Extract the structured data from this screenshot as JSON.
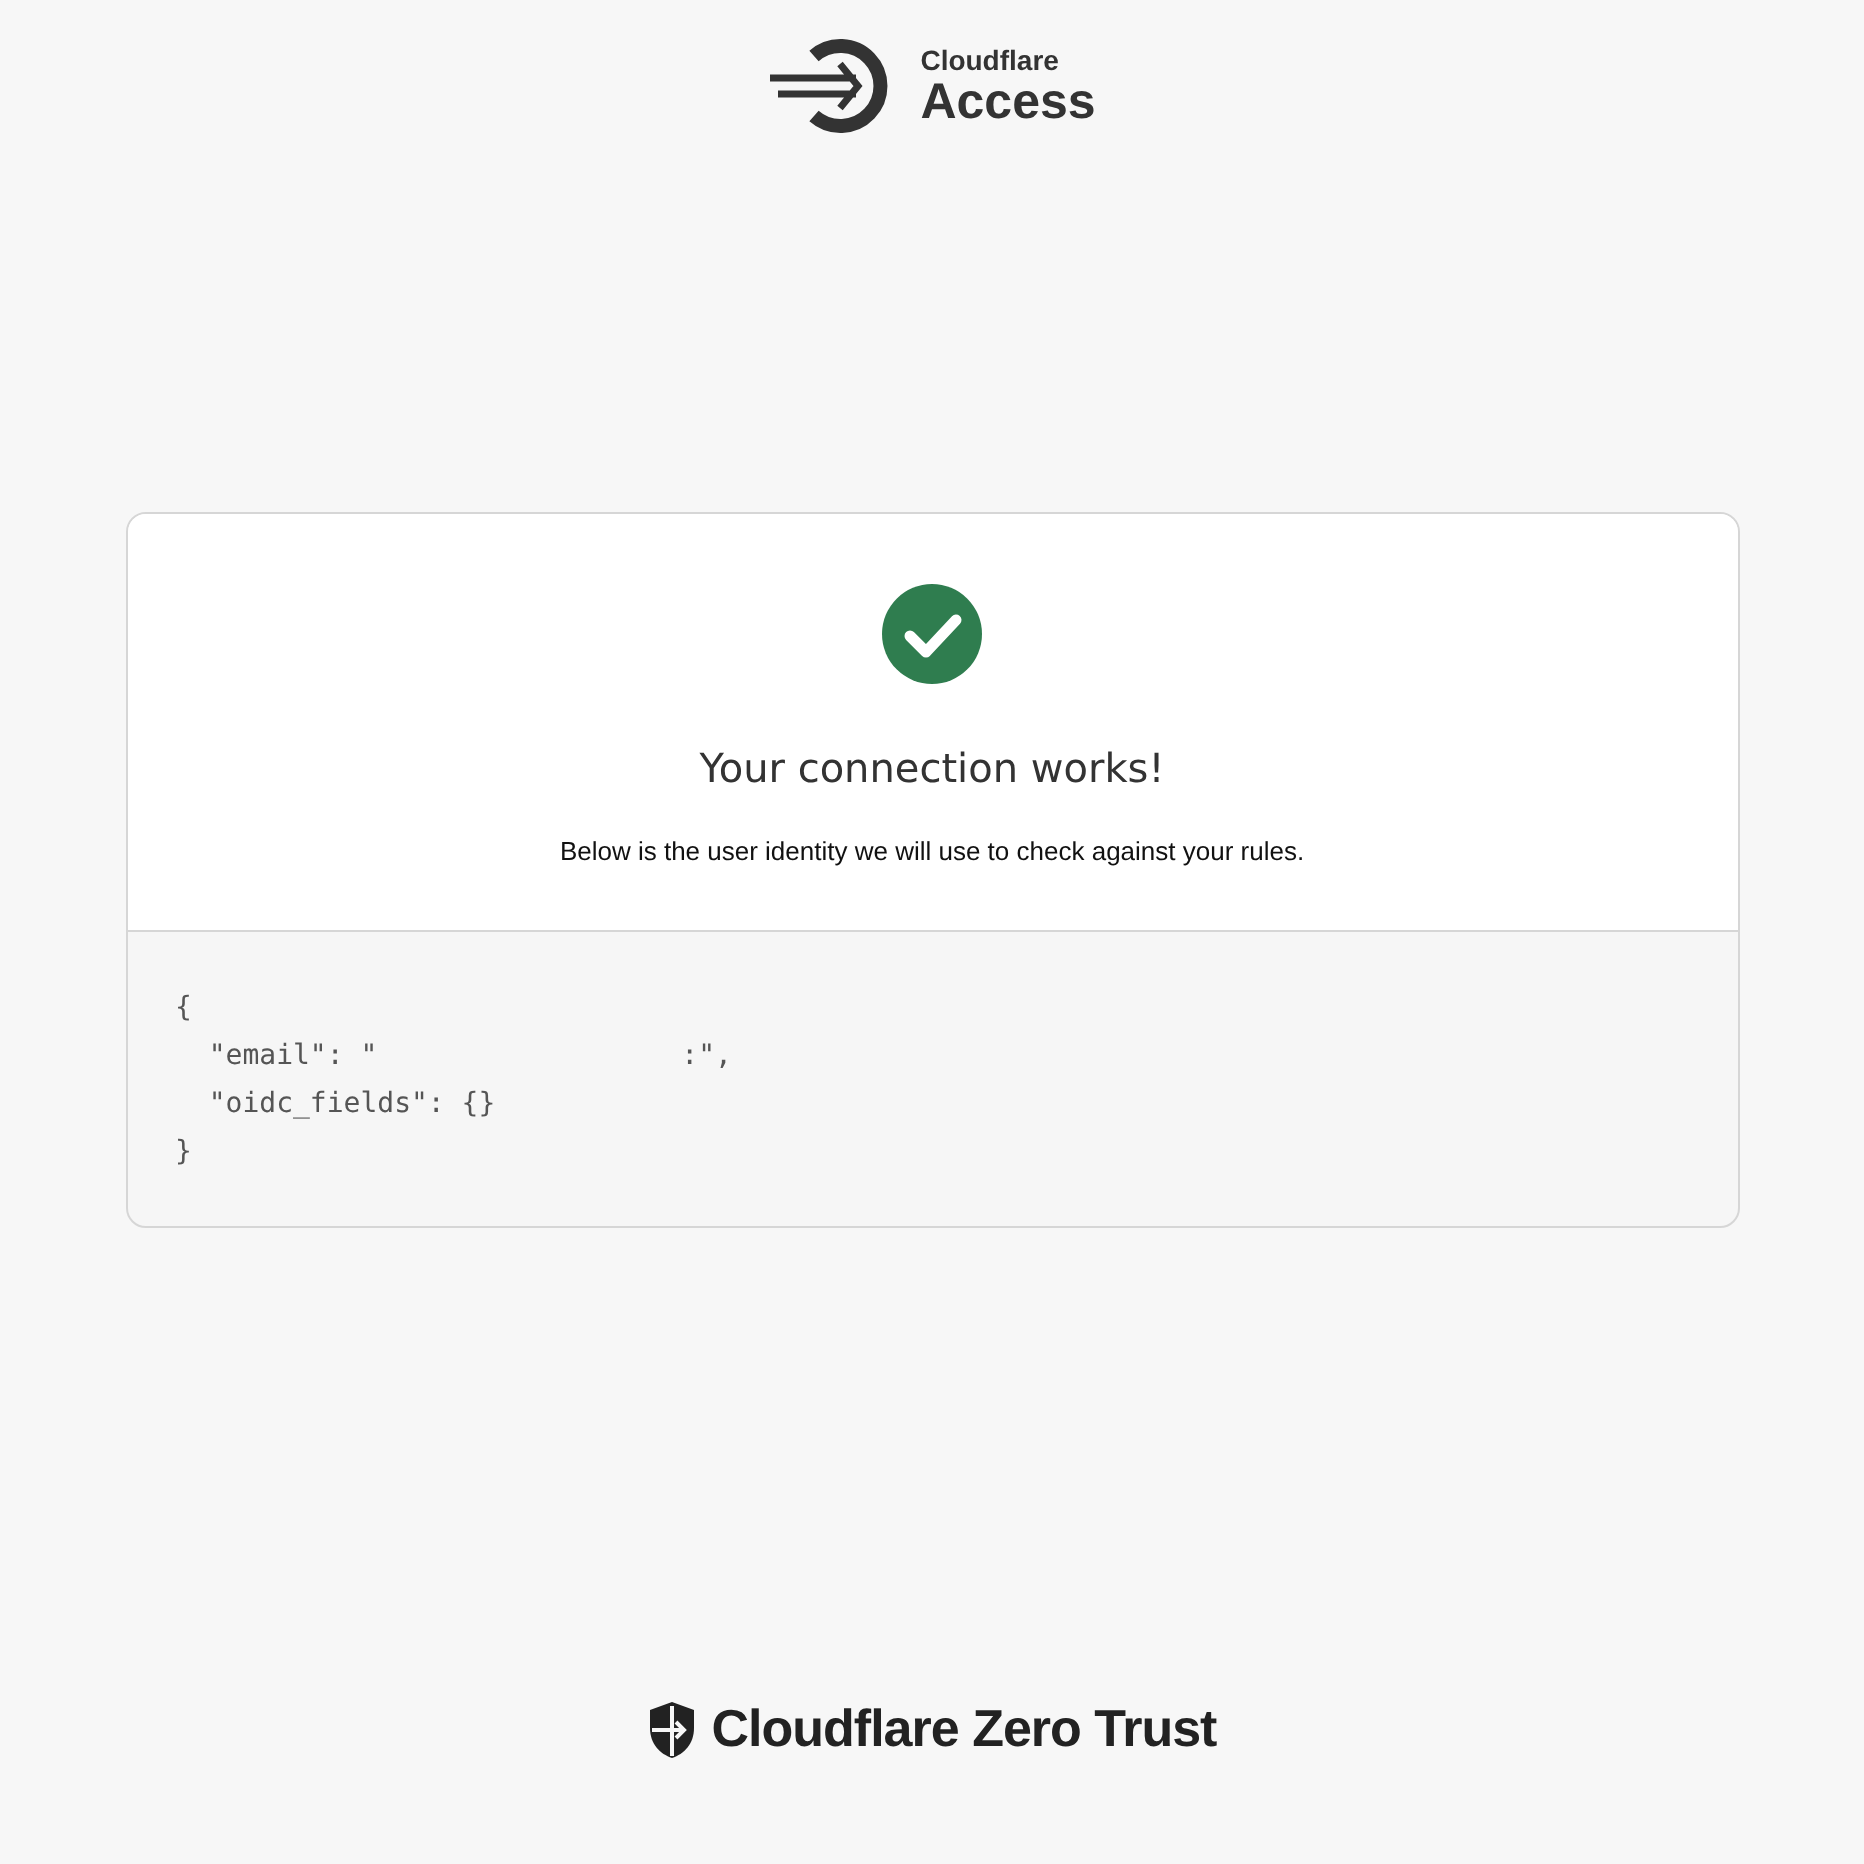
{
  "header": {
    "brand": "Cloudflare",
    "product": "Access"
  },
  "card": {
    "title": "Your connection works!",
    "description": "Below is the user identity we will use to check against your rules.",
    "code_lines": [
      {
        "kind": "plain",
        "text": "{"
      },
      {
        "kind": "redacted",
        "before": "  \"email\": \"",
        "after": ":\","
      },
      {
        "kind": "plain",
        "text": "  \"oidc_fields\": {}"
      },
      {
        "kind": "plain",
        "text": "}"
      }
    ]
  },
  "footer": {
    "brand": "Cloudflare Zero Trust"
  }
}
